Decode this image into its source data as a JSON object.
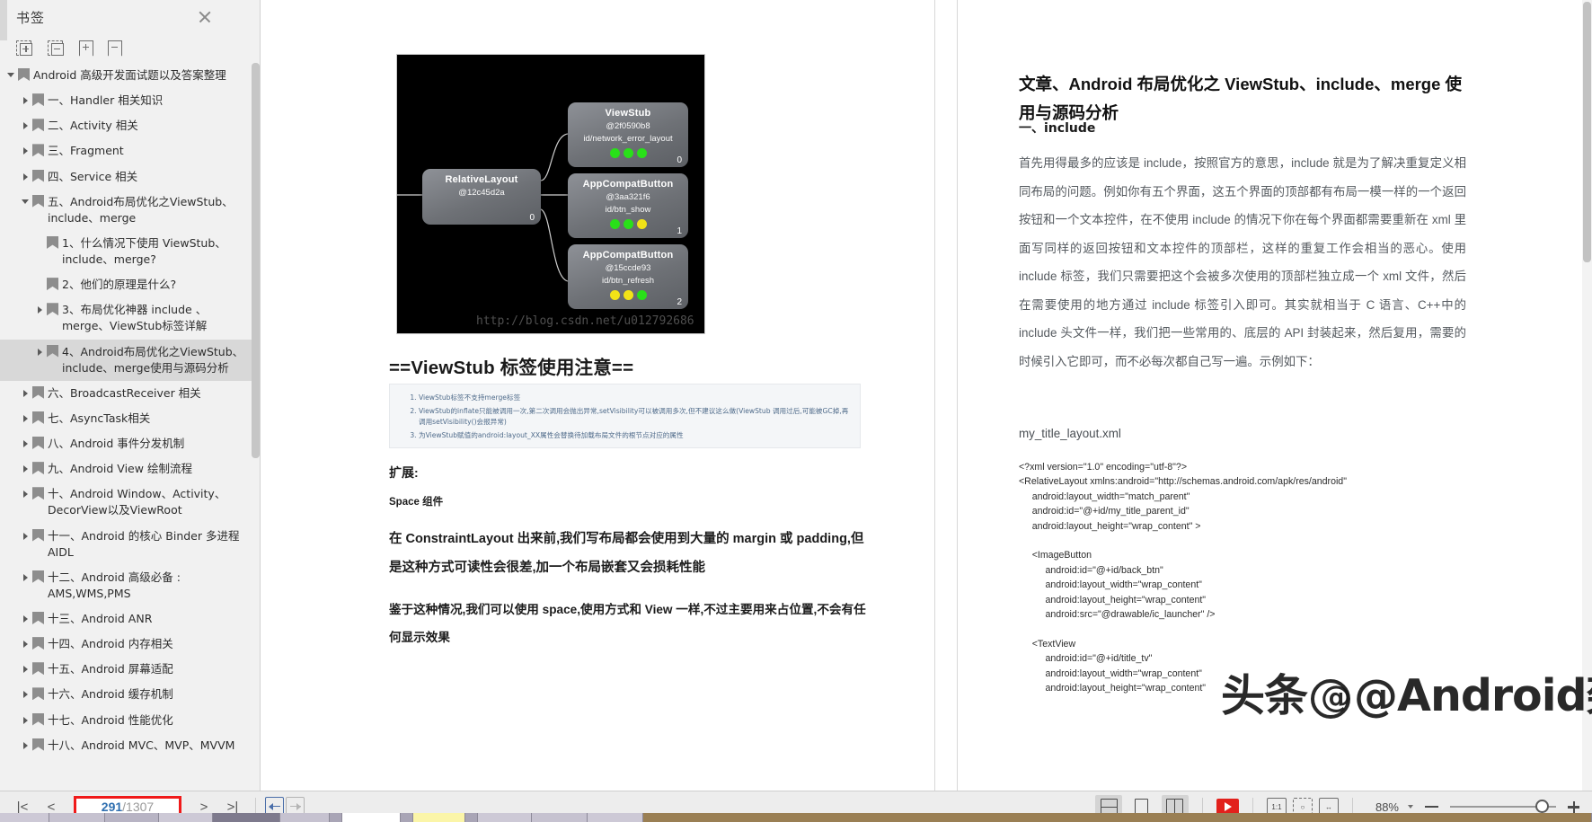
{
  "sidebar": {
    "title": "书签",
    "close_icon": "close-icon",
    "toolbar": [
      {
        "name": "expand-all-icon",
        "label": "展开全部"
      },
      {
        "name": "collapse-all-icon",
        "label": "折叠全部"
      },
      {
        "name": "add-bookmark-icon",
        "label": "添加书签"
      },
      {
        "name": "remove-bookmark-icon",
        "label": "删除书签"
      }
    ],
    "tree": [
      {
        "label": "Android 高级开发面试题以及答案整理",
        "depth": 0,
        "state": "open",
        "selected": false
      },
      {
        "label": "一、Handler 相关知识",
        "depth": 1,
        "state": "closed",
        "selected": false
      },
      {
        "label": "二、Activity 相关",
        "depth": 1,
        "state": "closed",
        "selected": false
      },
      {
        "label": "三、Fragment",
        "depth": 1,
        "state": "closed",
        "selected": false
      },
      {
        "label": "四、Service 相关",
        "depth": 1,
        "state": "closed",
        "selected": false
      },
      {
        "label": "五、Android布局优化之ViewStub、include、merge",
        "depth": 1,
        "state": "open",
        "selected": false
      },
      {
        "label": "1、什么情况下使用 ViewStub、include、merge?",
        "depth": 2,
        "state": "leaf",
        "selected": false
      },
      {
        "label": "2、他们的原理是什么?",
        "depth": 2,
        "state": "leaf",
        "selected": false
      },
      {
        "label": "3、布局优化神器 include 、merge、ViewStub标签详解",
        "depth": 2,
        "state": "closed",
        "selected": false
      },
      {
        "label": "4、Android布局优化之ViewStub、include、merge使用与源码分析",
        "depth": 2,
        "state": "closed",
        "selected": true
      },
      {
        "label": "六、BroadcastReceiver 相关",
        "depth": 1,
        "state": "closed",
        "selected": false
      },
      {
        "label": "七、AsyncTask相关",
        "depth": 1,
        "state": "closed",
        "selected": false
      },
      {
        "label": "八、Android 事件分发机制",
        "depth": 1,
        "state": "closed",
        "selected": false
      },
      {
        "label": "九、Android View 绘制流程",
        "depth": 1,
        "state": "closed",
        "selected": false
      },
      {
        "label": "十、Android Window、Activity、DecorView以及ViewRoot",
        "depth": 1,
        "state": "closed",
        "selected": false
      },
      {
        "label": "十一、Android 的核心 Binder 多进程 AIDL",
        "depth": 1,
        "state": "closed",
        "selected": false
      },
      {
        "label": "十二、Android 高级必备 : AMS,WMS,PMS",
        "depth": 1,
        "state": "closed",
        "selected": false
      },
      {
        "label": "十三、Android ANR",
        "depth": 1,
        "state": "closed",
        "selected": false
      },
      {
        "label": "十四、Android 内存相关",
        "depth": 1,
        "state": "closed",
        "selected": false
      },
      {
        "label": "十五、Android 屏幕适配",
        "depth": 1,
        "state": "closed",
        "selected": false
      },
      {
        "label": "十六、Android 缓存机制",
        "depth": 1,
        "state": "closed",
        "selected": false
      },
      {
        "label": "十七、Android 性能优化",
        "depth": 1,
        "state": "closed",
        "selected": false
      },
      {
        "label": "十八、Android MVC、MVP、MVVM",
        "depth": 1,
        "state": "closed",
        "selected": false
      }
    ]
  },
  "navbar": {
    "first_page_icon": "first-page-icon",
    "prev_page_icon": "prev-page-icon",
    "next_page_icon": "next-page-icon",
    "last_page_icon": "last-page-icon",
    "current_page": "291",
    "page_separator": "/",
    "total_pages": "1307",
    "go_back_icon": "go-back-icon",
    "go_forward_icon": "go-forward-icon",
    "view_modes": [
      {
        "name": "view-mode-continuous",
        "active": true
      },
      {
        "name": "view-mode-single-page",
        "active": false
      },
      {
        "name": "view-mode-two-page",
        "active": true
      }
    ],
    "present_icon": "presentation-play-icon",
    "fit_actual_label": "1:1",
    "fit_page_icon": "fit-page-icon",
    "fit_width_icon": "fit-width-icon",
    "zoom_level": "88%",
    "zoom_out_icon": "zoom-out-icon",
    "zoom_in_icon": "zoom-in-icon"
  },
  "left_page": {
    "diagram": {
      "type": "view-hierarchy",
      "watermark_url": "http://blog.csdn.net/u012792686",
      "nodes": [
        {
          "name": "RelativeLayout",
          "addr": "@12c45d2a",
          "id": "",
          "index": "0",
          "dots": []
        },
        {
          "name": "ViewStub",
          "addr": "@2f0590b8",
          "id": "id/network_error_layout",
          "index": "0",
          "dots": [
            "#29e019",
            "#29e019",
            "#29e019"
          ]
        },
        {
          "name": "AppCompatButton",
          "addr": "@3aa321f6",
          "id": "id/btn_show",
          "index": "1",
          "dots": [
            "#29e019",
            "#29e019",
            "#f2e317"
          ]
        },
        {
          "name": "AppCompatButton",
          "addr": "@15ccde93",
          "id": "id/btn_refresh",
          "index": "2",
          "dots": [
            "#f2e317",
            "#f2e317",
            "#29e019"
          ]
        }
      ]
    },
    "heading": "==ViewStub 标签使用注意==",
    "notes": [
      "ViewStub标签不支持merge标签",
      "ViewStub的inflate只能被调用一次,第二次调用会抛出异常,setVisibility可以被调用多次,但不建议这么做(ViewStub 调用过后,可能被GC掉,再调用setVisibility()会报异常)",
      "为ViewStub赋值的android:layout_XX属性会替换待加载布局文件的根节点对应的属性"
    ],
    "extend_label": "扩展:",
    "space_label": "Space 组件",
    "para1": "在 ConstraintLayout 出来前,我们写布局都会使用到大量的 margin 或 padding,但是这种方式可读性会很差,加一个布局嵌套又会损耗性能",
    "para2": "鉴于这种情况,我们可以使用 space,使用方式和 View 一样,不过主要用来占位置,不会有任何显示效果"
  },
  "right_page": {
    "title": "文章、Android 布局优化之 ViewStub、include、merge 使用与源码分析",
    "subheading": "一、include",
    "paragraph": "首先用得最多的应该是 include，按照官方的意思，include 就是为了解决重复定义相同布局的问题。例如你有五个界面，这五个界面的顶部都有布局一模一样的一个返回按钮和一个文本控件，在不使用 include 的情况下你在每个界面都需要重新在 xml 里面写同样的返回按钮和文本控件的顶部栏，这样的重复工作会相当的恶心。使用 include 标签，我们只需要把这个会被多次使用的顶部栏独立成一个 xml 文件，然后在需要使用的地方通过 include 标签引入即可。其实就相当于 C 语言、C++中的 include 头文件一样，我们把一些常用的、底层的 API 封装起来，然后复用，需要的时候引入它即可，而不必每次都自己写一遍。示例如下：",
    "filename": "my_title_layout.xml",
    "code": "<?xml version=\"1.0\" encoding=\"utf-8\"?>\n<RelativeLayout xmlns:android=\"http://schemas.android.com/apk/res/android\"\n     android:layout_width=\"match_parent\"\n     android:id=\"@+id/my_title_parent_id\"\n     android:layout_height=\"wrap_content\" >\n\n     <ImageButton\n          android:id=\"@+id/back_btn\"\n          android:layout_width=\"wrap_content\"\n          android:layout_height=\"wrap_content\"\n          android:src=\"@drawable/ic_launcher\" />\n\n     <TextView\n          android:id=\"@+id/title_tv\"\n          android:layout_width=\"wrap_content\"\n          android:layout_height=\"wrap_content\""
  },
  "watermark": {
    "prefix": "头条",
    "handle": "@Android架构解析"
  },
  "colors": {
    "accent_red": "#f01a1a",
    "page_number_blue": "#2f6fb0",
    "sidebar_bg": "#f1f1f1",
    "selection_gray": "#d8d8d8",
    "diagram_bg": "#000000",
    "node_gray": "#6e7176",
    "dot_green": "#29e019",
    "dot_yellow": "#f2e317",
    "play_red": "#e2211c"
  }
}
